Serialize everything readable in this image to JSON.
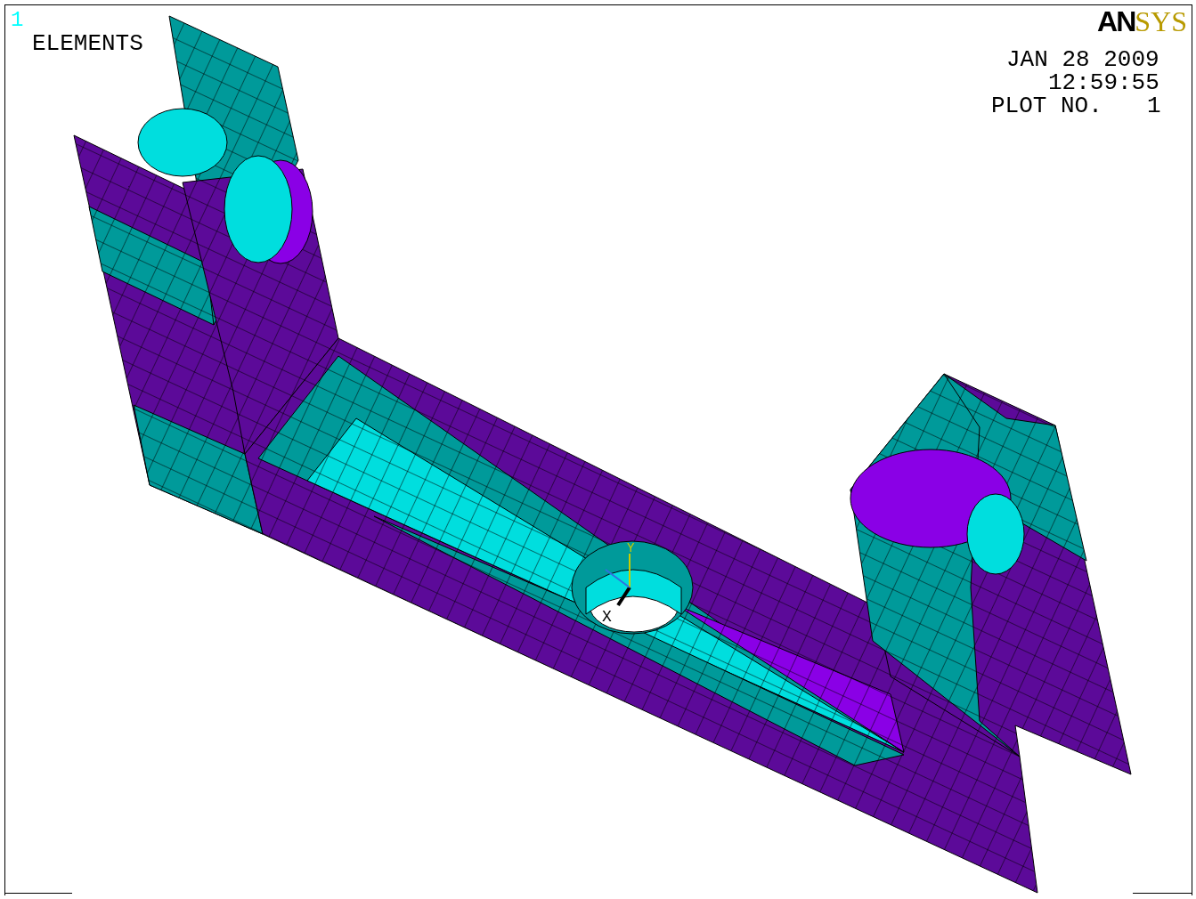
{
  "plot": {
    "window_number": "1",
    "title": "ELEMENTS",
    "logo": {
      "dark_part": "AN",
      "light_part": "SYS"
    },
    "date": "JAN 28 2009",
    "time": "12:59:55",
    "plot_no_label": "PLOT NO.",
    "plot_no_value": "1",
    "triad": {
      "y_label": "Y",
      "x_label": "X"
    }
  }
}
